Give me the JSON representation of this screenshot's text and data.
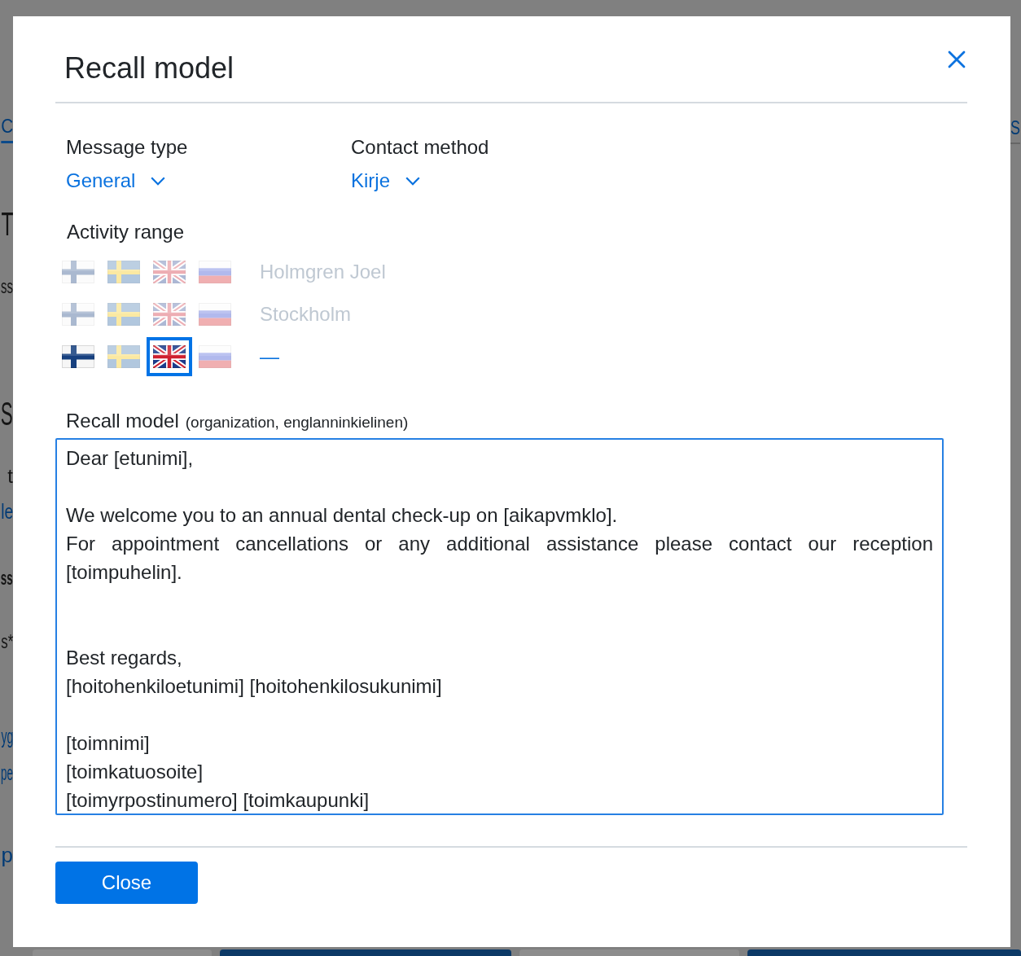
{
  "background_page": {
    "left_fragments": [
      {
        "text": "C",
        "kind": "tab",
        "selected": true
      },
      {
        "text": "T",
        "kind": "heading"
      },
      {
        "text": "ss",
        "kind": "text"
      },
      {
        "text": "S",
        "kind": "heading"
      },
      {
        "text": "t",
        "kind": "text"
      },
      {
        "text": "le",
        "kind": "link"
      },
      {
        "text": "ss",
        "kind": "bold"
      },
      {
        "text": "s*",
        "kind": "text"
      },
      {
        "text": "yg",
        "kind": "link"
      },
      {
        "text": "pe",
        "kind": "link"
      },
      {
        "text": "p",
        "kind": "link"
      }
    ],
    "right_fragments": [
      {
        "text": "S",
        "kind": "tab",
        "selected": false
      }
    ]
  },
  "dialog": {
    "title": "Recall model",
    "selects": [
      {
        "label": "Message type",
        "value": "General"
      },
      {
        "label": "Contact method",
        "value": "Kirje"
      }
    ],
    "activity_range": {
      "label": "Activity range",
      "rows": [
        {
          "label": "Holmgren Joel",
          "disabled": true,
          "flags": [
            {
              "kind": "fi",
              "on": false,
              "selected": false
            },
            {
              "kind": "se",
              "on": false,
              "selected": false
            },
            {
              "kind": "gb",
              "on": false,
              "selected": false
            },
            {
              "kind": "ru",
              "on": false,
              "selected": false
            }
          ]
        },
        {
          "label": "Stockholm",
          "disabled": true,
          "flags": [
            {
              "kind": "fi",
              "on": false,
              "selected": false
            },
            {
              "kind": "se",
              "on": false,
              "selected": false
            },
            {
              "kind": "gb",
              "on": false,
              "selected": false
            },
            {
              "kind": "ru",
              "on": false,
              "selected": false
            }
          ]
        },
        {
          "label": "—",
          "disabled": false,
          "flags": [
            {
              "kind": "fi",
              "on": true,
              "selected": false
            },
            {
              "kind": "se",
              "on": false,
              "selected": false
            },
            {
              "kind": "gb",
              "on": true,
              "selected": true
            },
            {
              "kind": "ru",
              "on": false,
              "selected": false
            }
          ]
        }
      ]
    },
    "recall_model": {
      "label": "Recall model",
      "note": "(organization, englanninkielinen)",
      "text": "Dear [etunimi],\n\nWe welcome you to an annual dental check-up on [aikapvmklo].\nFor appointment cancellations or any additional assistance please contact our reception [toimpuhelin].\n\n\nBest regards,\n[hoitohenkiloetunimi] [hoitohenkilosukunimi]\n\n[toimnimi]\n[toimkatuosoite]\n[toimyrpostinumero] [toimkaupunki]"
    },
    "buttons": [
      {
        "label": "Close"
      }
    ]
  }
}
